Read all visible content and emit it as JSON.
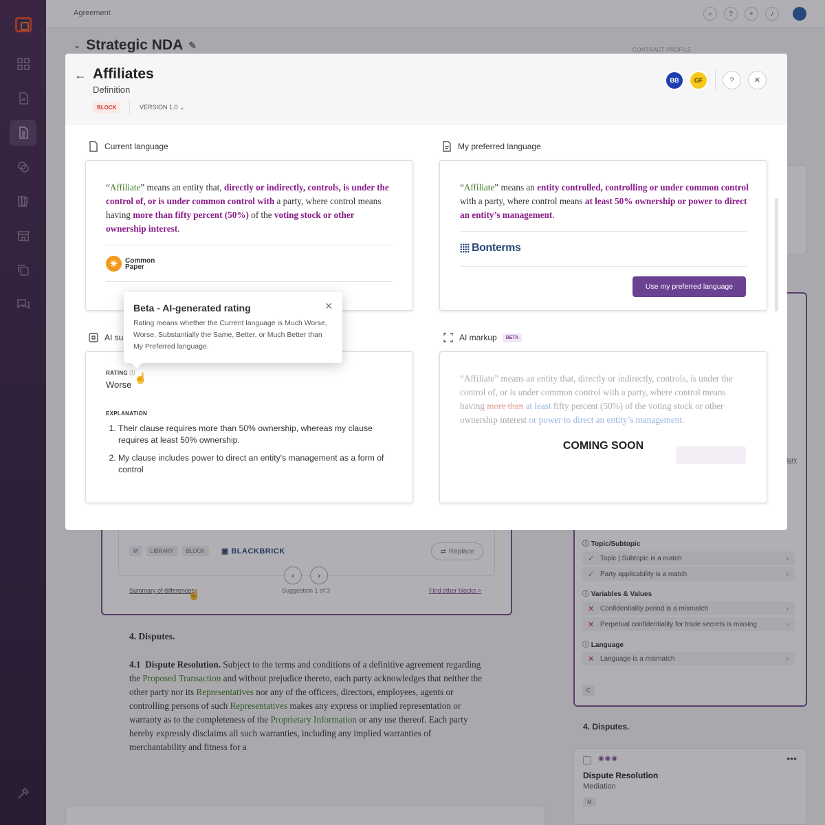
{
  "topbar": {
    "breadcrumb": "Agreement"
  },
  "document": {
    "title": "Strategic NDA",
    "contract_profile_label": "CONTRACT PROFILE"
  },
  "background_suggestion": {
    "tags": [
      "M",
      "LIBRARY",
      "BLOCK"
    ],
    "source_name": "BLACKBRICK",
    "replace_label": "Replace",
    "summary_link": "Summary of differences",
    "suggestion_counter": "Suggestion 1 of 3",
    "find_link": "Find other blocks >"
  },
  "background_clause": {
    "heading": "4.  Disputes.",
    "section_number": "4.1",
    "section_title": "Dispute Resolution.",
    "text_parts": [
      {
        "t": " Subject to the terms and conditions of a definitive agreement regarding the ",
        "hl": false
      },
      {
        "t": "Proposed Transaction",
        "hl": true
      },
      {
        "t": " and without prejudice thereto, each party acknowledges that neither the other party nor its ",
        "hl": false
      },
      {
        "t": "Representatives",
        "hl": true
      },
      {
        "t": " nor any of the officers, directors, employees, agents or controlling persons of such ",
        "hl": false
      },
      {
        "t": "Representatives",
        "hl": true
      },
      {
        "t": " makes any express or implied representation or warranty as to the completeness of the ",
        "hl": false
      },
      {
        "t": "Proprietary Information",
        "hl": true
      },
      {
        "t": " or any use thereof. Each party hereby expressly disclaims all such warranties, including any implied warranties of merchantability and fitness for a",
        "hl": false
      }
    ]
  },
  "right_panel": {
    "topic_header": "Topic/Subtopic",
    "topic_rows": [
      "Topic | Subtopic is a match",
      "Party applicability is a match"
    ],
    "variables_header": "Variables & Values",
    "variables_rows": [
      "Confidentiality period is a mismatch",
      "Perpetual confidentiality for trade secrets is missing"
    ],
    "language_header": "Language",
    "language_rows": [
      "Language is a mismatch"
    ],
    "c_tag": "C",
    "disputes_heading": "4.  Disputes.",
    "card_title": "Dispute Resolution",
    "card_subtitle": "Mediation",
    "card_tag": "M",
    "partial_link": "tory"
  },
  "modal": {
    "title": "Affiliates",
    "subtitle": "Definition",
    "block_tag": "BLOCK",
    "version": "VERSION 1.0",
    "avatars": [
      "BB",
      "GF"
    ],
    "help": "?",
    "close": "✕",
    "current_label": "Current language",
    "preferred_label": "My preferred language",
    "ai_summary_label": "AI su",
    "ai_markup_label": "AI markup",
    "beta_badge": "BETA",
    "current_clause": [
      {
        "t": "“",
        "c": ""
      },
      {
        "t": "Affiliate",
        "c": "g"
      },
      {
        "t": "” means an entity that, ",
        "c": ""
      },
      {
        "t": "directly or indirectly, controls, is under the control of, or is under common control with",
        "c": "p"
      },
      {
        "t": " a party, where control means having ",
        "c": ""
      },
      {
        "t": "more than fifty percent (50%)",
        "c": "p"
      },
      {
        "t": " of the ",
        "c": ""
      },
      {
        "t": "voting stock or other ownership interest",
        "c": "p"
      },
      {
        "t": ".",
        "c": ""
      }
    ],
    "current_source_line1": "Common",
    "current_source_line2": "Paper",
    "preferred_clause": [
      {
        "t": "“",
        "c": ""
      },
      {
        "t": "Affiliate",
        "c": "g"
      },
      {
        "t": "” means an ",
        "c": ""
      },
      {
        "t": "entity controlled, controlling or under common control",
        "c": "p"
      },
      {
        "t": " with a party, where control means ",
        "c": ""
      },
      {
        "t": "at least 50% ownership or power to direct an entity’s management",
        "c": "p"
      },
      {
        "t": ".",
        "c": ""
      }
    ],
    "preferred_source": "Bonterms",
    "use_button": "Use my preferred language",
    "rating_label": "RATING",
    "rating_value": "Worse",
    "explanation_label": "EXPLANATION",
    "explanations": [
      "Their clause requires more than 50% ownership, whereas my clause requires at least 50% ownership.",
      "My clause includes power to direct an entity's management as a form of control"
    ],
    "markup_clause": [
      {
        "t": "“Affiliate” means an entity that, directly or indirectly, controls, is under the control of, or is under common control with a party, where control means having ",
        "c": ""
      },
      {
        "t": "more than",
        "c": "del"
      },
      {
        "t": " ",
        "c": ""
      },
      {
        "t": "at least",
        "c": "ins"
      },
      {
        "t": " fifty percent (50%) of the voting stock or other ownership interest ",
        "c": ""
      },
      {
        "t": "or power to direct an entity’s management",
        "c": "ins"
      },
      {
        "t": ".",
        "c": ""
      }
    ],
    "coming_soon": "COMING SOON"
  },
  "tooltip": {
    "title": "Beta - AI-generated rating",
    "body": "Rating means whether the Current language is Much Worse, Worse, Substantially the Same, Better, or Much Better than My Preferred language.",
    "close": "✕"
  },
  "colors": {
    "accent": "#6b4292",
    "sidebar": "#3b2445",
    "highlight_purple": "#8a1d8a",
    "highlight_green": "#3f7a22"
  }
}
